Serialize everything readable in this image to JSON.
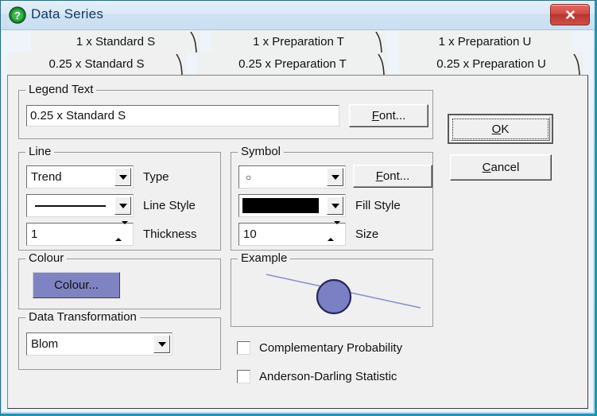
{
  "window": {
    "title": "Data Series",
    "icon": "question-mark-icon",
    "close_label": "✖"
  },
  "tabs": {
    "row1": [
      {
        "label": "1 x Standard S",
        "active": false
      },
      {
        "label": "1 x Preparation T",
        "active": false
      },
      {
        "label": "1 x Preparation U",
        "active": false
      }
    ],
    "row2": [
      {
        "label": "0.25 x Standard S",
        "active": true
      },
      {
        "label": "0.25 x Preparation T",
        "active": false
      },
      {
        "label": "0.25 x Preparation U",
        "active": false
      }
    ]
  },
  "legend_text": {
    "group_label": "Legend Text",
    "value": "0.25 x Standard S",
    "placeholder": "",
    "font_button": "Font..."
  },
  "line": {
    "group_label": "Line",
    "type_value": "Trend",
    "type_label": "Type",
    "style_value": "",
    "style_label": "Line Style",
    "thickness_value": "1",
    "thickness_label": "Thickness"
  },
  "symbol": {
    "group_label": "Symbol",
    "shape_value": "○",
    "font_button": "Font...",
    "fill_value": "",
    "fill_label": "Fill Style",
    "size_value": "10",
    "size_label": "Size",
    "fill_colour": "#000000"
  },
  "colour": {
    "group_label": "Colour",
    "button_label": "Colour...",
    "button_colour": "#8083c1"
  },
  "data_transformation": {
    "group_label": "Data Transformation",
    "value": "Blom"
  },
  "example": {
    "group_label": "Example",
    "marker_fill": "#7b7fc4",
    "marker_outline": "#262659",
    "line_colour": "#8c90cf"
  },
  "checkboxes": [
    {
      "label": "Complementary Probability",
      "checked": false
    },
    {
      "label": "Anderson-Darling Statistic",
      "checked": false
    }
  ],
  "actions": {
    "ok": "OK",
    "ok_accel": "O",
    "cancel": "Cancel",
    "cancel_accel": "C"
  }
}
